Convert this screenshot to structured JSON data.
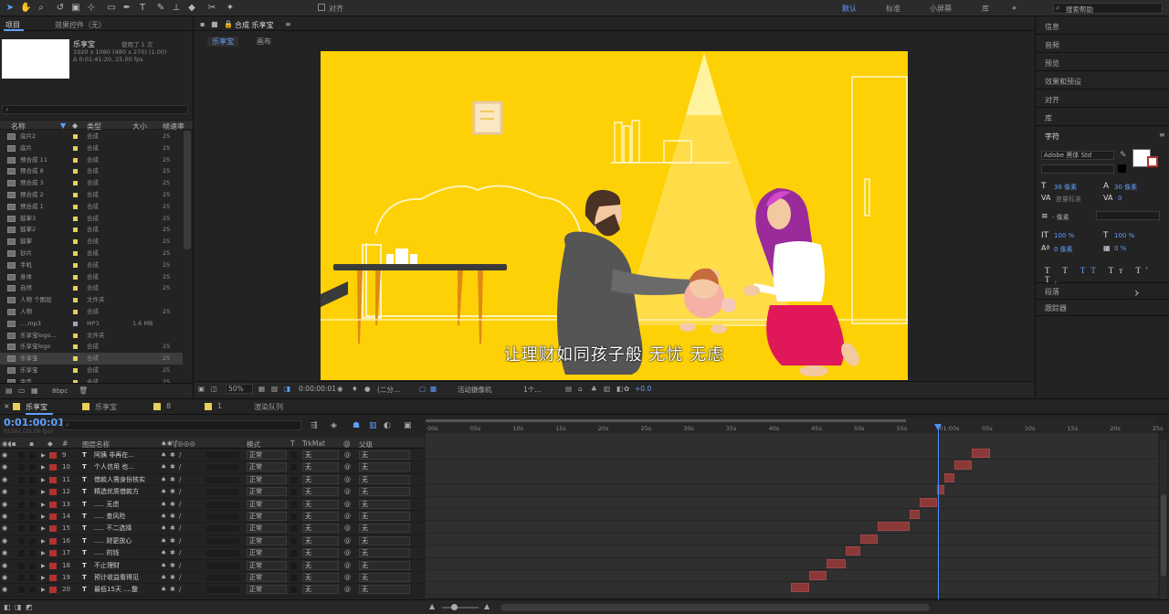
{
  "toolbar": {
    "snap_label": "对齐",
    "workspaces": [
      "默认",
      "标准",
      "小屏幕",
      "库"
    ],
    "search_placeholder": "搜索帮助"
  },
  "project": {
    "tabs": [
      "项目",
      "效果控件（无）"
    ],
    "selected_name": "乐享宝",
    "used": "使用了 1 次",
    "dims": "1920 x 1080 (480 x 270) (1.00)",
    "duration": "Δ 0:01:41:20, 25.00 fps",
    "columns": {
      "name": "名称",
      "type": "类型",
      "size": "大小",
      "fps": "帧速率"
    },
    "items": [
      {
        "name": "底片2",
        "type": "合成",
        "size": "",
        "fps": "25",
        "color": "#e6cf5a",
        "folder": false
      },
      {
        "name": "底片",
        "type": "合成",
        "size": "",
        "fps": "25",
        "color": "#e6cf5a",
        "folder": false
      },
      {
        "name": "预合成 11",
        "type": "合成",
        "size": "",
        "fps": "25",
        "color": "#e6cf5a",
        "folder": false
      },
      {
        "name": "预合成 8",
        "type": "合成",
        "size": "",
        "fps": "25",
        "color": "#e6cf5a",
        "folder": false
      },
      {
        "name": "预合成 3",
        "type": "合成",
        "size": "",
        "fps": "25",
        "color": "#e6cf5a",
        "folder": false
      },
      {
        "name": "预合成 2",
        "type": "合成",
        "size": "",
        "fps": "25",
        "color": "#e6cf5a",
        "folder": false
      },
      {
        "name": "预合成 1",
        "type": "合成",
        "size": "",
        "fps": "25",
        "color": "#e6cf5a",
        "folder": false
      },
      {
        "name": "鼓掌3",
        "type": "合成",
        "size": "",
        "fps": "25",
        "color": "#e6cf5a",
        "folder": false
      },
      {
        "name": "鼓掌2",
        "type": "合成",
        "size": "",
        "fps": "25",
        "color": "#e6cf5a",
        "folder": false
      },
      {
        "name": "鼓掌",
        "type": "合成",
        "size": "",
        "fps": "25",
        "color": "#e6cf5a",
        "folder": false
      },
      {
        "name": "钞片",
        "type": "合成",
        "size": "",
        "fps": "25",
        "color": "#e6cf5a",
        "folder": false
      },
      {
        "name": "手机",
        "type": "合成",
        "size": "",
        "fps": "25",
        "color": "#e6cf5a",
        "folder": false
      },
      {
        "name": "身体",
        "type": "合成",
        "size": "",
        "fps": "25",
        "color": "#e6cf5a",
        "folder": false
      },
      {
        "name": "自然",
        "type": "合成",
        "size": "",
        "fps": "25",
        "color": "#e6cf5a",
        "folder": false
      },
      {
        "name": "人物 个图层",
        "type": "文件夹",
        "size": "",
        "fps": "",
        "color": "#e6cf5a",
        "folder": true
      },
      {
        "name": "人物",
        "type": "合成",
        "size": "",
        "fps": "25",
        "color": "#e6cf5a",
        "folder": false
      },
      {
        "name": "....mp3",
        "type": "MP3",
        "size": "1.6 MB",
        "fps": "",
        "color": "#9aa6b5",
        "folder": false
      },
      {
        "name": "乐享宝logo...",
        "type": "文件夹",
        "size": "",
        "fps": "",
        "color": "#e6cf5a",
        "folder": true
      },
      {
        "name": "乐享宝logo",
        "type": "合成",
        "size": "",
        "fps": "25",
        "color": "#e6cf5a",
        "folder": false
      },
      {
        "name": "乐享宝",
        "type": "合成",
        "size": "",
        "fps": "25",
        "color": "#e6cf5a",
        "folder": false,
        "selected": true
      },
      {
        "name": "乐享宝",
        "type": "合成",
        "size": "",
        "fps": "25",
        "color": "#e6cf5a",
        "folder": false
      },
      {
        "name": "金币",
        "type": "合成",
        "size": "",
        "fps": "25",
        "color": "#e6cf5a",
        "folder": false
      }
    ],
    "bpc": "8bpc"
  },
  "comp": {
    "tab_title": "合成 乐享宝",
    "breadcrumb": "乐享宝",
    "crumb2": "画布",
    "subtitle": "让理财如同孩子般  无忧  无虑",
    "zoom": "50%",
    "timecode": "0:00:00:01",
    "resolution": "(二分...",
    "camera": "活动摄像机",
    "views": "1个...",
    "exposure": "+0.0"
  },
  "right_panel": {
    "items": [
      "信息",
      "音频",
      "预览",
      "效果和预设",
      "对齐",
      "库"
    ],
    "char_title": "字符",
    "font": "Adobe 黑体 Std",
    "size": "36 像素",
    "leading": "30 像素",
    "kerning": "度量标准",
    "tracking": "0",
    "stroke": "- 像素",
    "vscale": "100 %",
    "hscale": "100 %",
    "baseline": "0 像素",
    "tsume": "0 %",
    "bottom_items": [
      "段落",
      "跟踪器"
    ]
  },
  "timeline": {
    "tabs": [
      "乐享宝",
      "乐享宝",
      "8",
      "1",
      "渲染队列"
    ],
    "timecode": "0:01:00:01",
    "subframe": "01501 (25.00 fps)",
    "col_headers": {
      "num": "#",
      "name": "图层名称",
      "mode": "模式",
      "t": "T",
      "trkmat": "TrkMat",
      "parent": "父级"
    },
    "ruler": [
      "00s",
      "05s",
      "10s",
      "15s",
      "20s",
      "25s",
      "30s",
      "35s",
      "40s",
      "45s",
      "50s",
      "55s",
      "01:00s",
      "05s",
      "10s",
      "15s",
      "20s",
      "25s"
    ],
    "layers": [
      {
        "num": "9",
        "name": "阿姨 非再在...",
        "mode": "正常",
        "trk": "无",
        "parent": "无",
        "bar": [
          64.0,
          66.2
        ]
      },
      {
        "num": "10",
        "name": "个人信用 也...",
        "mode": "正常",
        "trk": "无",
        "parent": "无",
        "bar": [
          62.0,
          64.0
        ]
      },
      {
        "num": "11",
        "name": "借款人需身份核实",
        "mode": "正常",
        "trk": "无",
        "parent": "无",
        "bar": [
          60.8,
          62.0
        ]
      },
      {
        "num": "12",
        "name": "精选优质借款方",
        "mode": "正常",
        "trk": "无",
        "parent": "无",
        "bar": [
          60.0,
          60.8
        ]
      },
      {
        "num": "13",
        "name": "..... 无虑",
        "mode": "正常",
        "trk": "无",
        "parent": "无",
        "bar": [
          57.9,
          60.0
        ]
      },
      {
        "num": "14",
        "name": "..... 查风险",
        "mode": "正常",
        "trk": "无",
        "parent": "无",
        "bar": [
          56.7,
          57.9
        ]
      },
      {
        "num": "15",
        "name": "..... 不二选择",
        "mode": "正常",
        "trk": "无",
        "parent": "无",
        "bar": [
          53.0,
          56.7
        ]
      },
      {
        "num": "16",
        "name": "..... 财更放心",
        "mode": "正常",
        "trk": "无",
        "parent": "无",
        "bar": [
          51.0,
          53.0
        ]
      },
      {
        "num": "17",
        "name": "..... 的钱",
        "mode": "正常",
        "trk": "无",
        "parent": "无",
        "bar": [
          49.2,
          51.0
        ]
      },
      {
        "num": "18",
        "name": "不止理财",
        "mode": "正常",
        "trk": "无",
        "parent": "无",
        "bar": [
          47.0,
          49.2
        ]
      },
      {
        "num": "19",
        "name": "预计收益看得见",
        "mode": "正常",
        "trk": "无",
        "parent": "无",
        "bar": [
          45.0,
          47.0
        ]
      },
      {
        "num": "20",
        "name": "最低15天 ....整",
        "mode": "正常",
        "trk": "无",
        "parent": "无",
        "bar": [
          42.8,
          45.0
        ]
      }
    ],
    "playhead_sec": 60.04,
    "colors": {
      "label": "#b23131",
      "bar": "#8b3838",
      "accent": "#5fa0ff"
    }
  }
}
